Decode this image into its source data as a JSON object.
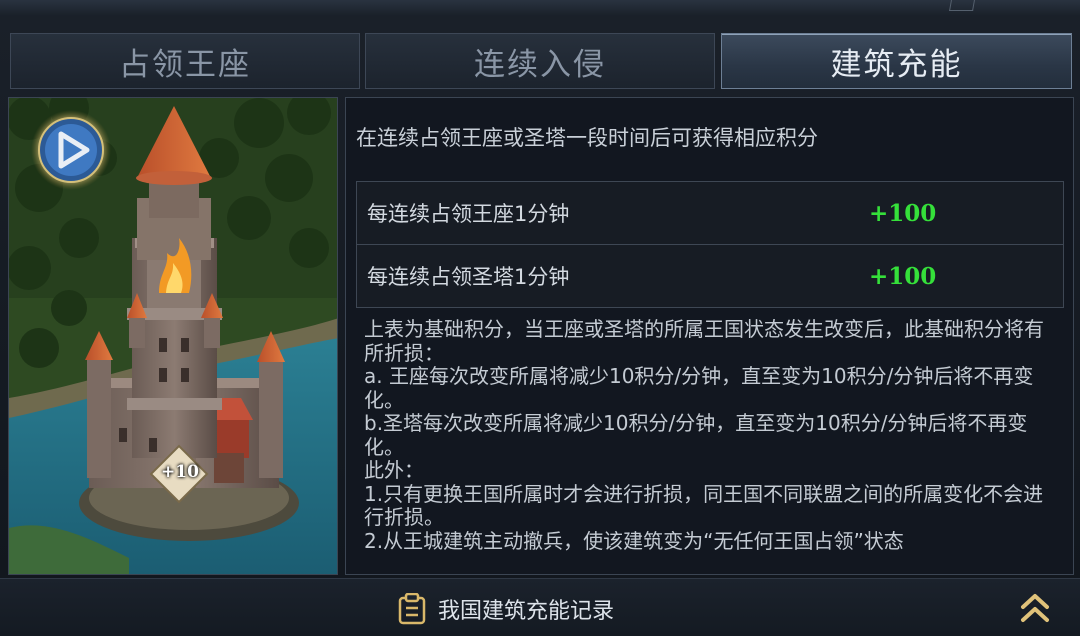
{
  "tabs": [
    {
      "label": "占领王座",
      "active": false
    },
    {
      "label": "连续入侵",
      "active": false
    },
    {
      "label": "建筑充能",
      "active": true
    }
  ],
  "intro": "在连续占领王座或圣塔一段时间后可获得相应积分",
  "score_rows": [
    {
      "label": "每连续占领王座1分钟",
      "value": "+100"
    },
    {
      "label": "每连续占领圣塔1分钟",
      "value": "+100"
    }
  ],
  "description": [
    "上表为基础积分，当王座或圣塔的所属王国状态发生改变后，此基础积分将有所折损：",
    "a. 王座每次改变所属将减少10积分/分钟，直至变为10积分/分钟后将不再变化。",
    "b.圣塔每次改变所属将减少10积分/分钟，直至变为10积分/分钟后将不再变化。",
    "此外：",
    "1.只有更换王国所属时才会进行折损，同王国不同联盟之间的所属变化不会进行折损。",
    "2.从王城建筑主动撤兵，使该建筑变为“无任何王国占领”状态"
  ],
  "building_badge": "+10",
  "footer": {
    "record_label": "我国建筑充能记录"
  },
  "colors": {
    "score_green": "#35e03a",
    "active_tab_text": "#e6ecf3"
  },
  "icons": {
    "play": "play-icon",
    "record": "clipboard-icon",
    "expand": "double-chevron-up-icon"
  }
}
